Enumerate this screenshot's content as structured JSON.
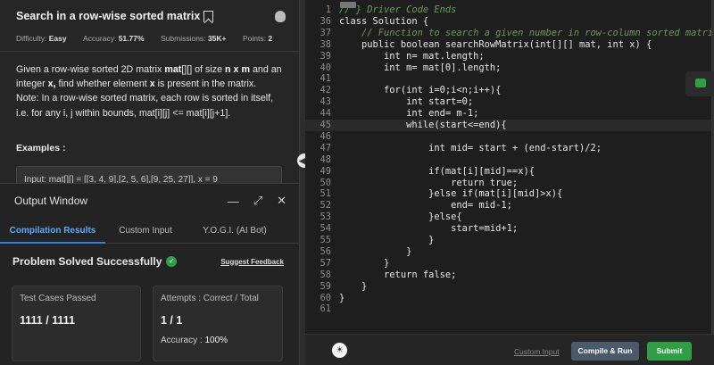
{
  "problem": {
    "title": "Search in a row-wise sorted matrix",
    "difficulty_label": "Difficulty:",
    "difficulty": "Easy",
    "accuracy_label": "Accuracy:",
    "accuracy": "51.77%",
    "submissions_label": "Submissions:",
    "submissions": "35K+",
    "points_label": "Points:",
    "points": "2",
    "desc1_pre": "Given a row-wise sorted 2D matrix ",
    "desc1_mat": "mat",
    "desc1_mid": "[][] of size ",
    "desc1_nxm": "n x m",
    "desc1_post": " and an integer ",
    "desc2_x": "x,",
    "desc2_mid": " find whether element ",
    "desc2_x2": "x",
    "desc2_post": " is present in the matrix.",
    "note1": "Note: In a row-wise sorted matrix, each row is sorted in itself, i.e. for any i, j within bounds, mat[i][j] <= mat[i][j+1].",
    "examples_label": "Examples :",
    "example_input": "Input:  mat[][] = [[3, 4, 9],[2, 5, 6],[9, 25, 27]], x = 9"
  },
  "output": {
    "title": "Output Window",
    "tabs": [
      "Compilation Results",
      "Custom Input",
      "Y.O.G.I. (AI Bot)"
    ],
    "status": "Problem Solved Successfully",
    "feedback": "Suggest Feedback",
    "card1_label": "Test Cases Passed",
    "card1_value": "1111 / 1111",
    "card2_label": "Attempts : Correct / Total",
    "card2_value": "1 / 1",
    "accuracy_label": "Accuracy : ",
    "accuracy_value": "100%"
  },
  "editor": {
    "lines": [
      {
        "n": "1",
        "t": "// } Driver Code Ends",
        "c": "cm"
      },
      {
        "n": "36",
        "t": "class Solution {",
        "c": ""
      },
      {
        "n": "37",
        "t": "    // Function to search a given number in row-column sorted matrix.",
        "c": "cm"
      },
      {
        "n": "38",
        "t": "    public boolean searchRowMatrix(int[][] mat, int x) {",
        "c": ""
      },
      {
        "n": "39",
        "t": "        int n= mat.length;",
        "c": ""
      },
      {
        "n": "40",
        "t": "        int m= mat[0].length;",
        "c": ""
      },
      {
        "n": "41",
        "t": "",
        "c": ""
      },
      {
        "n": "42",
        "t": "        for(int i=0;i<n;i++){",
        "c": ""
      },
      {
        "n": "43",
        "t": "            int start=0;",
        "c": ""
      },
      {
        "n": "44",
        "t": "            int end= m-1;",
        "c": ""
      },
      {
        "n": "45",
        "t": "            while(start<=end){",
        "c": "hl"
      },
      {
        "n": "46",
        "t": "",
        "c": ""
      },
      {
        "n": "47",
        "t": "                int mid= start + (end-start)/2;",
        "c": ""
      },
      {
        "n": "48",
        "t": "",
        "c": ""
      },
      {
        "n": "49",
        "t": "                if(mat[i][mid]==x){",
        "c": ""
      },
      {
        "n": "50",
        "t": "                    return true;",
        "c": ""
      },
      {
        "n": "51",
        "t": "                }else if(mat[i][mid]>x){",
        "c": ""
      },
      {
        "n": "52",
        "t": "                    end= mid-1;",
        "c": ""
      },
      {
        "n": "53",
        "t": "                }else{",
        "c": ""
      },
      {
        "n": "54",
        "t": "                    start=mid+1;",
        "c": ""
      },
      {
        "n": "55",
        "t": "                }",
        "c": ""
      },
      {
        "n": "56",
        "t": "            }",
        "c": ""
      },
      {
        "n": "57",
        "t": "        }",
        "c": ""
      },
      {
        "n": "58",
        "t": "        return false;",
        "c": ""
      },
      {
        "n": "59",
        "t": "    }",
        "c": ""
      },
      {
        "n": "60",
        "t": "}",
        "c": ""
      },
      {
        "n": "61",
        "t": "",
        "c": ""
      }
    ]
  },
  "footer": {
    "custom_input": "Custom Input",
    "compile": "Compile & Run",
    "submit": "Submit"
  }
}
